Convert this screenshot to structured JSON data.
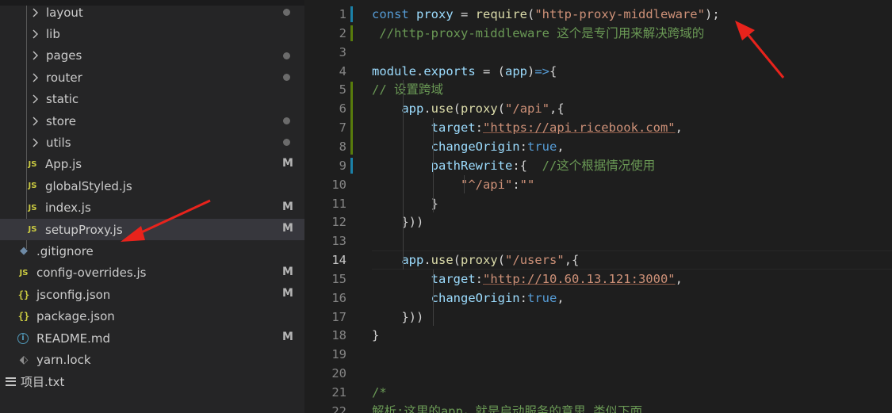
{
  "explorer": {
    "items": [
      {
        "name": "layout",
        "kind": "folder",
        "badge": "dot"
      },
      {
        "name": "lib",
        "kind": "folder",
        "badge": ""
      },
      {
        "name": "pages",
        "kind": "folder",
        "badge": "dot"
      },
      {
        "name": "router",
        "kind": "folder",
        "badge": "dot"
      },
      {
        "name": "static",
        "kind": "folder",
        "badge": ""
      },
      {
        "name": "store",
        "kind": "folder",
        "badge": "dot"
      },
      {
        "name": "utils",
        "kind": "folder",
        "badge": "dot"
      },
      {
        "name": "App.js",
        "kind": "js",
        "badge": "M"
      },
      {
        "name": "globalStyled.js",
        "kind": "js",
        "badge": ""
      },
      {
        "name": "index.js",
        "kind": "js",
        "badge": "M"
      },
      {
        "name": "setupProxy.js",
        "kind": "js",
        "badge": "M",
        "active": true
      },
      {
        "name": ".gitignore",
        "kind": "git",
        "badge": ""
      },
      {
        "name": "config-overrides.js",
        "kind": "js",
        "badge": "M"
      },
      {
        "name": "jsconfig.json",
        "kind": "json",
        "badge": "M"
      },
      {
        "name": "package.json",
        "kind": "json",
        "badge": ""
      },
      {
        "name": "README.md",
        "kind": "info",
        "badge": "M"
      },
      {
        "name": "yarn.lock",
        "kind": "yarn",
        "badge": ""
      },
      {
        "name": "项目.txt",
        "kind": "txt",
        "badge": ""
      }
    ],
    "icons": {
      "js": "JS",
      "json": "{}",
      "git": "◆",
      "info": "i",
      "yarn": "⬖",
      "dot_badge": "status-dot",
      "m_badge": "M"
    }
  },
  "editor": {
    "line_numbers": [
      "1",
      "2",
      "3",
      "4",
      "5",
      "6",
      "7",
      "8",
      "9",
      "10",
      "11",
      "12",
      "13",
      "14",
      "15",
      "16",
      "17",
      "18",
      "19",
      "20",
      "21",
      "22"
    ],
    "current_line": "14",
    "lines": [
      {
        "ln": "1",
        "segs": [
          [
            "kw",
            "const "
          ],
          [
            "var",
            "proxy"
          ],
          [
            "pl",
            " = "
          ],
          [
            "fn",
            "require"
          ],
          [
            "pl",
            "("
          ],
          [
            "str",
            "\"http-proxy-middleware\""
          ],
          [
            "pl",
            ");"
          ]
        ]
      },
      {
        "ln": "2",
        "segs": [
          [
            "cm",
            " //http-proxy-middleware 这个是专门用来解决跨域的"
          ]
        ]
      },
      {
        "ln": "3",
        "segs": []
      },
      {
        "ln": "4",
        "segs": [
          [
            "var",
            "module"
          ],
          [
            "pl",
            "."
          ],
          [
            "var",
            "exports"
          ],
          [
            "pl",
            " = ("
          ],
          [
            "var",
            "app"
          ],
          [
            "pl",
            ")"
          ],
          [
            "kw",
            "=>"
          ],
          [
            "pl",
            "{"
          ]
        ]
      },
      {
        "ln": "5",
        "segs": [
          [
            "cm",
            "// 设置跨域"
          ]
        ]
      },
      {
        "ln": "6",
        "segs": [
          [
            "pl",
            "    "
          ],
          [
            "var",
            "app"
          ],
          [
            "pl",
            "."
          ],
          [
            "fn",
            "use"
          ],
          [
            "pl",
            "("
          ],
          [
            "fn",
            "proxy"
          ],
          [
            "pl",
            "("
          ],
          [
            "str",
            "\"/api\""
          ],
          [
            "pl",
            ",{"
          ]
        ]
      },
      {
        "ln": "7",
        "segs": [
          [
            "pl",
            "        "
          ],
          [
            "var",
            "target"
          ],
          [
            "pl",
            ":"
          ],
          [
            "str",
            "\"https://api.ricebook.com\""
          ],
          [
            "pl",
            ","
          ]
        ]
      },
      {
        "ln": "8",
        "segs": [
          [
            "pl",
            "        "
          ],
          [
            "var",
            "changeOrigin"
          ],
          [
            "pl",
            ":"
          ],
          [
            "bool",
            "true"
          ],
          [
            "pl",
            ","
          ]
        ]
      },
      {
        "ln": "9",
        "segs": [
          [
            "pl",
            "        "
          ],
          [
            "var",
            "pathRewrite"
          ],
          [
            "pl",
            ":{  "
          ],
          [
            "cm",
            "//这个根据情况使用"
          ]
        ]
      },
      {
        "ln": "10",
        "segs": [
          [
            "pl",
            "            "
          ],
          [
            "str",
            "\"^/api\""
          ],
          [
            "pl",
            ":"
          ],
          [
            "str",
            "\"\""
          ]
        ]
      },
      {
        "ln": "11",
        "segs": [
          [
            "pl",
            "        }"
          ]
        ]
      },
      {
        "ln": "12",
        "segs": [
          [
            "pl",
            "    }))"
          ]
        ]
      },
      {
        "ln": "13",
        "segs": []
      },
      {
        "ln": "14",
        "segs": [
          [
            "pl",
            "    "
          ],
          [
            "var",
            "app"
          ],
          [
            "pl",
            "."
          ],
          [
            "fn",
            "use"
          ],
          [
            "pl",
            "("
          ],
          [
            "fn",
            "proxy"
          ],
          [
            "pl",
            "("
          ],
          [
            "str",
            "\"/users\""
          ],
          [
            "pl",
            ",{"
          ]
        ]
      },
      {
        "ln": "15",
        "segs": [
          [
            "pl",
            "        "
          ],
          [
            "var",
            "target"
          ],
          [
            "pl",
            ":"
          ],
          [
            "str",
            "\"http://10.60.13.121:3000\""
          ],
          [
            "pl",
            ","
          ]
        ]
      },
      {
        "ln": "16",
        "segs": [
          [
            "pl",
            "        "
          ],
          [
            "var",
            "changeOrigin"
          ],
          [
            "pl",
            ":"
          ],
          [
            "bool",
            "true"
          ],
          [
            "pl",
            ","
          ]
        ]
      },
      {
        "ln": "17",
        "segs": [
          [
            "pl",
            "    })"
          ],
          [
            "pl",
            ")"
          ]
        ]
      },
      {
        "ln": "18",
        "segs": [
          [
            "pl",
            "}"
          ]
        ]
      },
      {
        "ln": "19",
        "segs": []
      },
      {
        "ln": "20",
        "segs": []
      },
      {
        "ln": "21",
        "segs": [
          [
            "cm",
            "/*"
          ]
        ]
      },
      {
        "ln": "22",
        "segs": [
          [
            "cm",
            "解析:这里的app，就是启动服务的意思,类似下面"
          ]
        ]
      }
    ],
    "colors": {
      "keyword": "#569cd6",
      "variable": "#9cdcfe",
      "function": "#dcdcaa",
      "string": "#ce9178",
      "comment": "#6a9955",
      "gutter_modified": "#1b81a8",
      "gutter_added": "#587c0c",
      "annotation_arrow": "#e8231c"
    }
  }
}
